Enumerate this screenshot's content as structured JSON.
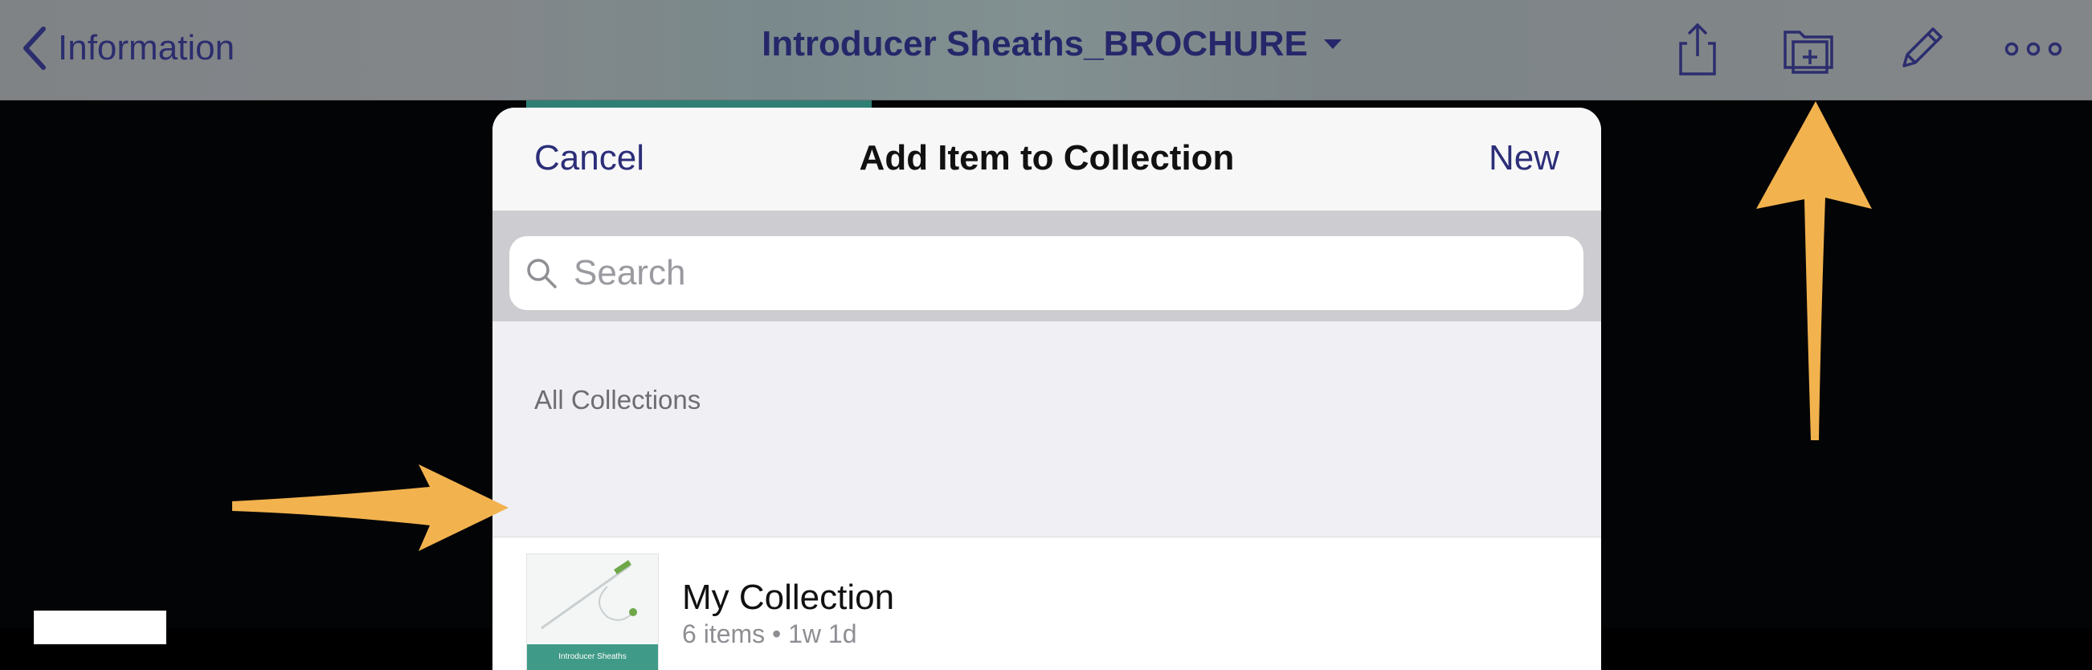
{
  "navbar": {
    "back_label": "Information",
    "title": "Introducer Sheaths_BROCHURE",
    "icons": [
      "share-icon",
      "add-to-collection-icon",
      "pencil-icon",
      "more-icon"
    ]
  },
  "sheet": {
    "cancel_label": "Cancel",
    "title": "Add Item to Collection",
    "new_label": "New"
  },
  "search": {
    "placeholder": "Search",
    "value": ""
  },
  "section": {
    "label": "All Collections"
  },
  "collections": [
    {
      "name": "My Collection",
      "meta": "6 items • 1w 1d",
      "thumb_caption": "Introducer Sheaths"
    }
  ],
  "colors": {
    "accent": "#2c2e78",
    "arrow": "#f2b24e",
    "thumb_band": "#3f9b88"
  }
}
